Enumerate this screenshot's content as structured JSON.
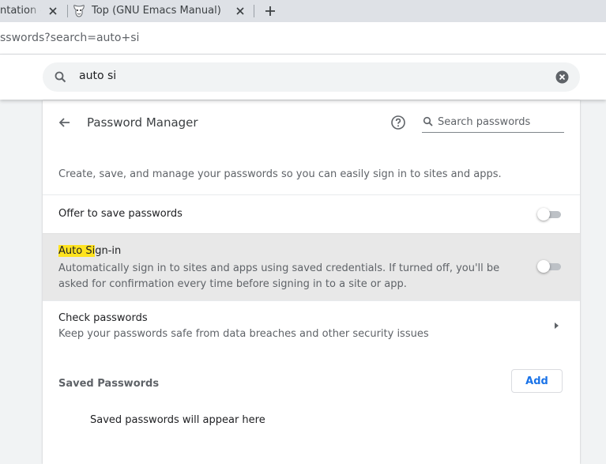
{
  "browser": {
    "tabs": [
      {
        "title": "ntation -",
        "close_icon": "close-icon"
      },
      {
        "title": "Top (GNU Emacs Manual)",
        "favicon": "gnu-head-icon",
        "close_icon": "close-icon"
      }
    ],
    "new_tab_icon": "plus-icon",
    "address_bar": {
      "url": "sswords?search=auto+si"
    }
  },
  "settings_search": {
    "icon": "search-icon",
    "query": "auto si",
    "clear_icon": "clear-circle-icon"
  },
  "password_manager": {
    "back_icon": "arrow-back-icon",
    "title": "Password Manager",
    "help_icon": "help-circle-icon",
    "search": {
      "icon": "search-icon",
      "placeholder": "Search passwords"
    },
    "description": "Create, save, and manage your passwords so you can easily sign in to sites and apps.",
    "offer_to_save": {
      "label": "Offer to save passwords",
      "enabled": false
    },
    "auto_signin": {
      "label_highlight": "Auto Si",
      "label_rest": "gn-in",
      "sublabel": "Automatically sign in to sites and apps using saved credentials. If turned off, you'll be asked for confirmation every time before signing in to a site or app.",
      "enabled": false
    },
    "check_passwords": {
      "label": "Check passwords",
      "sublabel": "Keep your passwords safe from data breaches and other security issues",
      "arrow_icon": "arrow-right-icon"
    },
    "saved_passwords": {
      "title": "Saved Passwords",
      "add_label": "Add",
      "empty_message": "Saved passwords will appear here"
    }
  },
  "colors": {
    "accent": "#1a73e8",
    "highlight": "#ffe31f",
    "toggle_off_track": "#bdc1c6"
  }
}
